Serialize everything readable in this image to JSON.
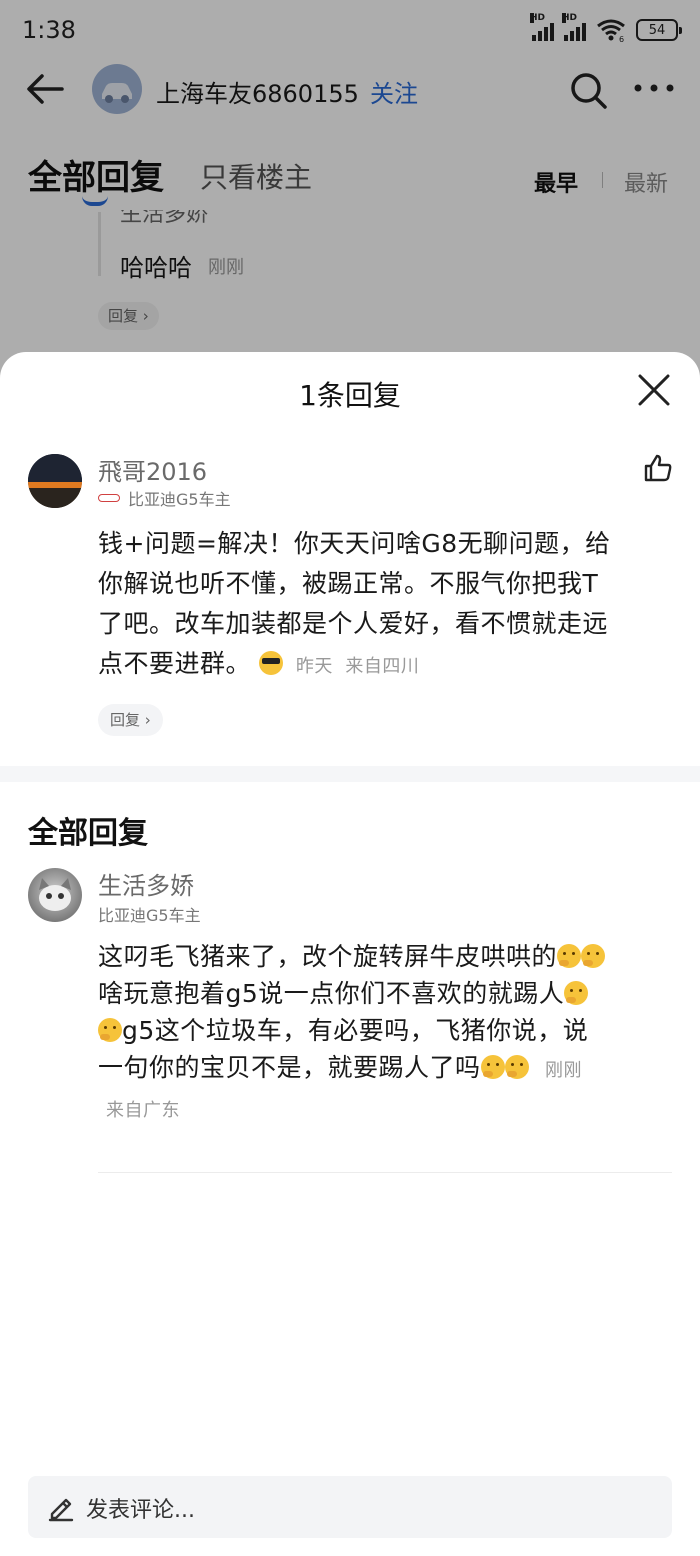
{
  "status_bar": {
    "time": "1:38",
    "hd1": "HD",
    "hd2": "HD",
    "wifi_sub": "6",
    "battery": "54"
  },
  "nav": {
    "user_name": "上海车友6860155",
    "follow_label": "关注"
  },
  "tabs": {
    "all_replies": "全部回复",
    "owner_only": "只看楼主",
    "sort_earliest": "最早",
    "sort_latest": "最新"
  },
  "background_reply": {
    "author_partial": "生活多娇",
    "text": "哈哈哈",
    "time": "刚刚",
    "reply_btn": "回复 ›"
  },
  "sheet": {
    "title": "1条回复",
    "post": {
      "author": "飛哥2016",
      "badge": "比亚迪G5车主",
      "text": "钱+问题=解决！你天天问啥G8无聊问题，给你解说也听不懂，被踢正常。不服气你把我T了吧。改车加装都是个人爱好，看不惯就走远点不要进群。",
      "emoji": "sunglasses-emoji",
      "time": "昨天",
      "location": "来自四川",
      "reply_btn": "回复 ›"
    },
    "all_replies_title": "全部回复",
    "reply": {
      "author": "生活多娇",
      "badge": "比亚迪G5车主",
      "seg1": "这叼毛飞猪来了，改个旋转屏牛皮哄哄的",
      "seg2": "啥玩意抱着g5说一点你们不喜欢的就踢人",
      "seg3": "g5这个垃圾车，有必要吗，飞猪你说，说一句你的宝贝不是，就要踢人了吗",
      "emoji": "thinking-emoji",
      "time": "刚刚",
      "location": "来自广东"
    },
    "comment_placeholder": "发表评论..."
  },
  "colors": {
    "accent": "#2a6ad6",
    "overlay": "rgba(0,0,0,0.32)"
  }
}
